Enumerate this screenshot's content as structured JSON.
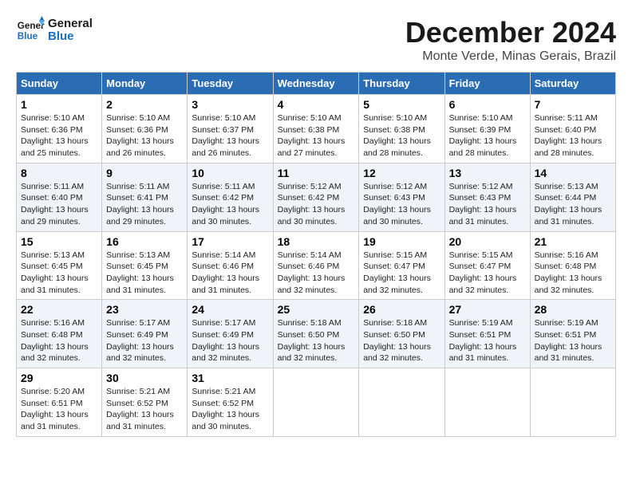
{
  "logo": {
    "line1": "General",
    "line2": "Blue"
  },
  "title": "December 2024",
  "subtitle": "Monte Verde, Minas Gerais, Brazil",
  "days_of_week": [
    "Sunday",
    "Monday",
    "Tuesday",
    "Wednesday",
    "Thursday",
    "Friday",
    "Saturday"
  ],
  "weeks": [
    [
      {
        "day": "1",
        "sunrise": "Sunrise: 5:10 AM",
        "sunset": "Sunset: 6:36 PM",
        "daylight": "Daylight: 13 hours and 25 minutes."
      },
      {
        "day": "2",
        "sunrise": "Sunrise: 5:10 AM",
        "sunset": "Sunset: 6:36 PM",
        "daylight": "Daylight: 13 hours and 26 minutes."
      },
      {
        "day": "3",
        "sunrise": "Sunrise: 5:10 AM",
        "sunset": "Sunset: 6:37 PM",
        "daylight": "Daylight: 13 hours and 26 minutes."
      },
      {
        "day": "4",
        "sunrise": "Sunrise: 5:10 AM",
        "sunset": "Sunset: 6:38 PM",
        "daylight": "Daylight: 13 hours and 27 minutes."
      },
      {
        "day": "5",
        "sunrise": "Sunrise: 5:10 AM",
        "sunset": "Sunset: 6:38 PM",
        "daylight": "Daylight: 13 hours and 28 minutes."
      },
      {
        "day": "6",
        "sunrise": "Sunrise: 5:10 AM",
        "sunset": "Sunset: 6:39 PM",
        "daylight": "Daylight: 13 hours and 28 minutes."
      },
      {
        "day": "7",
        "sunrise": "Sunrise: 5:11 AM",
        "sunset": "Sunset: 6:40 PM",
        "daylight": "Daylight: 13 hours and 28 minutes."
      }
    ],
    [
      {
        "day": "8",
        "sunrise": "Sunrise: 5:11 AM",
        "sunset": "Sunset: 6:40 PM",
        "daylight": "Daylight: 13 hours and 29 minutes."
      },
      {
        "day": "9",
        "sunrise": "Sunrise: 5:11 AM",
        "sunset": "Sunset: 6:41 PM",
        "daylight": "Daylight: 13 hours and 29 minutes."
      },
      {
        "day": "10",
        "sunrise": "Sunrise: 5:11 AM",
        "sunset": "Sunset: 6:42 PM",
        "daylight": "Daylight: 13 hours and 30 minutes."
      },
      {
        "day": "11",
        "sunrise": "Sunrise: 5:12 AM",
        "sunset": "Sunset: 6:42 PM",
        "daylight": "Daylight: 13 hours and 30 minutes."
      },
      {
        "day": "12",
        "sunrise": "Sunrise: 5:12 AM",
        "sunset": "Sunset: 6:43 PM",
        "daylight": "Daylight: 13 hours and 30 minutes."
      },
      {
        "day": "13",
        "sunrise": "Sunrise: 5:12 AM",
        "sunset": "Sunset: 6:43 PM",
        "daylight": "Daylight: 13 hours and 31 minutes."
      },
      {
        "day": "14",
        "sunrise": "Sunrise: 5:13 AM",
        "sunset": "Sunset: 6:44 PM",
        "daylight": "Daylight: 13 hours and 31 minutes."
      }
    ],
    [
      {
        "day": "15",
        "sunrise": "Sunrise: 5:13 AM",
        "sunset": "Sunset: 6:45 PM",
        "daylight": "Daylight: 13 hours and 31 minutes."
      },
      {
        "day": "16",
        "sunrise": "Sunrise: 5:13 AM",
        "sunset": "Sunset: 6:45 PM",
        "daylight": "Daylight: 13 hours and 31 minutes."
      },
      {
        "day": "17",
        "sunrise": "Sunrise: 5:14 AM",
        "sunset": "Sunset: 6:46 PM",
        "daylight": "Daylight: 13 hours and 31 minutes."
      },
      {
        "day": "18",
        "sunrise": "Sunrise: 5:14 AM",
        "sunset": "Sunset: 6:46 PM",
        "daylight": "Daylight: 13 hours and 32 minutes."
      },
      {
        "day": "19",
        "sunrise": "Sunrise: 5:15 AM",
        "sunset": "Sunset: 6:47 PM",
        "daylight": "Daylight: 13 hours and 32 minutes."
      },
      {
        "day": "20",
        "sunrise": "Sunrise: 5:15 AM",
        "sunset": "Sunset: 6:47 PM",
        "daylight": "Daylight: 13 hours and 32 minutes."
      },
      {
        "day": "21",
        "sunrise": "Sunrise: 5:16 AM",
        "sunset": "Sunset: 6:48 PM",
        "daylight": "Daylight: 13 hours and 32 minutes."
      }
    ],
    [
      {
        "day": "22",
        "sunrise": "Sunrise: 5:16 AM",
        "sunset": "Sunset: 6:48 PM",
        "daylight": "Daylight: 13 hours and 32 minutes."
      },
      {
        "day": "23",
        "sunrise": "Sunrise: 5:17 AM",
        "sunset": "Sunset: 6:49 PM",
        "daylight": "Daylight: 13 hours and 32 minutes."
      },
      {
        "day": "24",
        "sunrise": "Sunrise: 5:17 AM",
        "sunset": "Sunset: 6:49 PM",
        "daylight": "Daylight: 13 hours and 32 minutes."
      },
      {
        "day": "25",
        "sunrise": "Sunrise: 5:18 AM",
        "sunset": "Sunset: 6:50 PM",
        "daylight": "Daylight: 13 hours and 32 minutes."
      },
      {
        "day": "26",
        "sunrise": "Sunrise: 5:18 AM",
        "sunset": "Sunset: 6:50 PM",
        "daylight": "Daylight: 13 hours and 32 minutes."
      },
      {
        "day": "27",
        "sunrise": "Sunrise: 5:19 AM",
        "sunset": "Sunset: 6:51 PM",
        "daylight": "Daylight: 13 hours and 31 minutes."
      },
      {
        "day": "28",
        "sunrise": "Sunrise: 5:19 AM",
        "sunset": "Sunset: 6:51 PM",
        "daylight": "Daylight: 13 hours and 31 minutes."
      }
    ],
    [
      {
        "day": "29",
        "sunrise": "Sunrise: 5:20 AM",
        "sunset": "Sunset: 6:51 PM",
        "daylight": "Daylight: 13 hours and 31 minutes."
      },
      {
        "day": "30",
        "sunrise": "Sunrise: 5:21 AM",
        "sunset": "Sunset: 6:52 PM",
        "daylight": "Daylight: 13 hours and 31 minutes."
      },
      {
        "day": "31",
        "sunrise": "Sunrise: 5:21 AM",
        "sunset": "Sunset: 6:52 PM",
        "daylight": "Daylight: 13 hours and 30 minutes."
      },
      null,
      null,
      null,
      null
    ]
  ]
}
